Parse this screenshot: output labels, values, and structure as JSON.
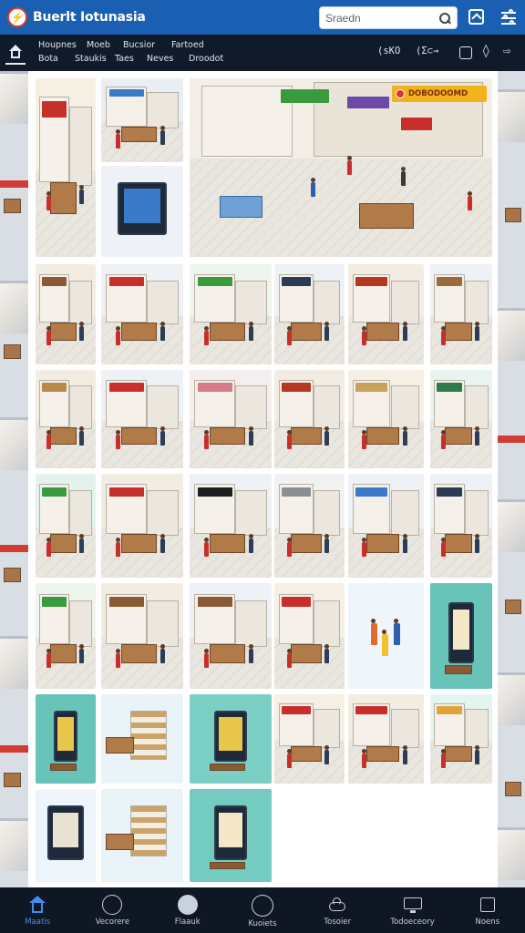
{
  "app": {
    "brand": "Buerlt Iotunasia",
    "logo_text": "⚡"
  },
  "search": {
    "placeholder": "Sraedn"
  },
  "subnav": {
    "row1": [
      "Houpnes",
      "Moeb",
      "Bucsior",
      "Fartoed"
    ],
    "row2": [
      "Bota",
      "Staukis",
      "Taes",
      "Neves",
      "Droodot"
    ],
    "tools": {
      "zoom_label": "(sKO",
      "link_label": "(Σ⊂→"
    }
  },
  "hero": {
    "banner_text": "DOBODOOMD"
  },
  "colors": {
    "topbar": "#1b5fb3",
    "subbar": "#101a2b",
    "accent_sign_red": "#c7302a",
    "accent_sign_green": "#3a9a3e",
    "accent_teal": "#68c4b8",
    "bottomnav": "#0f1624",
    "active_nav": "#3e8df0"
  },
  "tiles": [
    {
      "id": "t1",
      "theme": "sign-red",
      "sign": "#c7302a",
      "bg": "#f6efe3"
    },
    {
      "id": "t2",
      "theme": "shop-blue",
      "sign": "#3b7ac9",
      "bg": "#e9eef4"
    },
    {
      "id": "t3",
      "theme": "poster-blue",
      "sign": "#2f6fd0",
      "bg": "#eef1f5"
    },
    {
      "id": "t4",
      "theme": "shop-wood",
      "sign": "#8a5a35",
      "bg": "#f2ece3"
    },
    {
      "id": "t5",
      "theme": "shop-red",
      "sign": "#c7302a",
      "bg": "#eef1f5"
    },
    {
      "id": "t6",
      "theme": "shop-green",
      "sign": "#3a9a3e",
      "bg": "#eef4ee"
    },
    {
      "id": "t7",
      "theme": "shop-dark",
      "sign": "#2b3a55",
      "bg": "#eef1f5"
    },
    {
      "id": "t8",
      "theme": "kiosk",
      "sign": "#b2381f",
      "bg": "#f2ece3"
    },
    {
      "id": "t9",
      "theme": "shop-wood",
      "sign": "#9a6b3a",
      "bg": "#eef1f5"
    },
    {
      "id": "t10",
      "theme": "shop-wood",
      "sign": "#b78a4a",
      "bg": "#f2ece3"
    },
    {
      "id": "t11",
      "theme": "shop-red",
      "sign": "#c7302a",
      "bg": "#eef1f5"
    },
    {
      "id": "t12",
      "theme": "shop-pink",
      "sign": "#d87a8a",
      "bg": "#f4eeef"
    },
    {
      "id": "t13",
      "theme": "shop-red",
      "sign": "#b2381f",
      "bg": "#f2ece3"
    },
    {
      "id": "t14",
      "theme": "kiosk",
      "sign": "#c7a25a",
      "bg": "#f6efe3"
    },
    {
      "id": "t15",
      "theme": "shop-green",
      "sign": "#2d7a4a",
      "bg": "#e9f3ef"
    },
    {
      "id": "t16",
      "theme": "shop-green",
      "sign": "#3a9a3e",
      "bg": "#e4f2ee"
    },
    {
      "id": "t17",
      "theme": "shop-red",
      "sign": "#c7302a",
      "bg": "#f2ece3"
    },
    {
      "id": "t18",
      "theme": "shop-dark",
      "sign": "#1f1f1f",
      "bg": "#eef1f5"
    },
    {
      "id": "t19",
      "theme": "shop-gray",
      "sign": "#8a8f96",
      "bg": "#f2f2f2"
    },
    {
      "id": "t20",
      "theme": "shop-blue",
      "sign": "#3b7ac9",
      "bg": "#eef1f5"
    },
    {
      "id": "t21",
      "theme": "shop-dark",
      "sign": "#2b3a55",
      "bg": "#eef1f5"
    },
    {
      "id": "t22",
      "theme": "shop-green",
      "sign": "#3a9a3e",
      "bg": "#eef4ee"
    },
    {
      "id": "t23",
      "theme": "shop-wood",
      "sign": "#8a5a35",
      "bg": "#f2ece3"
    },
    {
      "id": "t24",
      "theme": "shop-wood",
      "sign": "#8a5a35",
      "bg": "#eef1f5"
    },
    {
      "id": "t25",
      "theme": "kiosk",
      "sign": "#c7302a",
      "bg": "#f6efe3"
    },
    {
      "id": "t26",
      "theme": "people",
      "sign": "#e26b2f",
      "bg": "#eef6fb"
    },
    {
      "id": "t27",
      "theme": "teal-board",
      "sign": "#68c4b8",
      "bg": "#68c4b8"
    },
    {
      "id": "t28",
      "theme": "teal-poster",
      "sign": "#68c4b8",
      "bg": "#68c4b8"
    },
    {
      "id": "t29",
      "theme": "shelf",
      "sign": "#c9a36a",
      "bg": "#eaf3f8"
    },
    {
      "id": "t30",
      "theme": "teal-poster",
      "sign": "#68c4b8",
      "bg": "#7ccfc4"
    },
    {
      "id": "t31",
      "theme": "kiosk-red",
      "sign": "#c7302a",
      "bg": "#f6efe3"
    },
    {
      "id": "t32",
      "theme": "shop-red",
      "sign": "#c7302a",
      "bg": "#f2ece3"
    },
    {
      "id": "t33",
      "theme": "shop-wood",
      "sign": "#e0a33a",
      "bg": "#e4f4ef"
    },
    {
      "id": "t34",
      "theme": "poster-pair",
      "sign": "#6a6f78",
      "bg": "#eef6fb"
    },
    {
      "id": "t35",
      "theme": "shelf",
      "sign": "#8a5a35",
      "bg": "#eaf3f8"
    },
    {
      "id": "t36",
      "theme": "teal-board",
      "sign": "#68c4b8",
      "bg": "#74ccc0"
    }
  ],
  "bottom_nav": [
    {
      "label": "Maatis",
      "icon": "home-icon",
      "active": true
    },
    {
      "label": "Vecorere",
      "icon": "compass-icon",
      "active": false
    },
    {
      "label": "Flaauk",
      "icon": "globe-icon",
      "active": false
    },
    {
      "label": "Kuoiets",
      "icon": "shop-icon",
      "active": false
    },
    {
      "label": "Tosoier",
      "icon": "cloud-icon",
      "active": false
    },
    {
      "label": "Todoeceory",
      "icon": "display-icon",
      "active": false
    },
    {
      "label": "Noens",
      "icon": "square-icon",
      "active": false
    }
  ]
}
